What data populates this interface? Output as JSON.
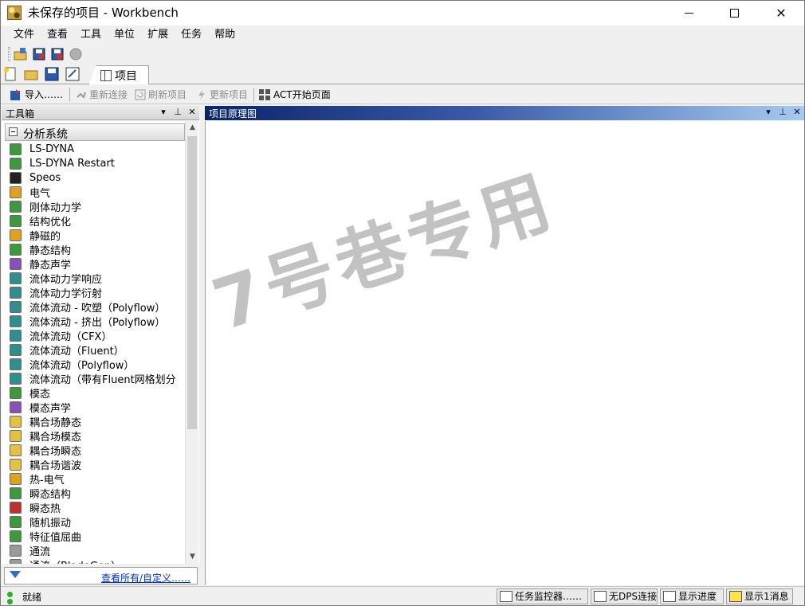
{
  "window": {
    "title": "未保存的项目 - Workbench",
    "controls": {
      "minimize": "—",
      "maximize": "☐",
      "close": "✕"
    }
  },
  "menu": [
    "文件",
    "查看",
    "工具",
    "单位",
    "扩展",
    "任务",
    "帮助"
  ],
  "tabs": {
    "project": "项目"
  },
  "toolbar3": {
    "import": "导入……",
    "reconnect": "重新连接",
    "refresh": "刷新项目",
    "update": "更新项目",
    "act_start": "ACT开始页面"
  },
  "toolbox": {
    "header": "工具箱",
    "group": "分析系统",
    "items": [
      {
        "label": "LS-DYNA",
        "icon": "green"
      },
      {
        "label": "LS-DYNA Restart",
        "icon": "green"
      },
      {
        "label": "Speos",
        "icon": "dark"
      },
      {
        "label": "电气",
        "icon": "orange"
      },
      {
        "label": "刚体动力学",
        "icon": "green"
      },
      {
        "label": "结构优化",
        "icon": "green"
      },
      {
        "label": "静磁的",
        "icon": "orange"
      },
      {
        "label": "静态结构",
        "icon": "green"
      },
      {
        "label": "静态声学",
        "icon": "purple"
      },
      {
        "label": "流体动力学响应",
        "icon": "teal"
      },
      {
        "label": "流体动力学衍射",
        "icon": "teal"
      },
      {
        "label": "流体流动 - 吹塑（Polyflow）",
        "icon": "teal"
      },
      {
        "label": "流体流动 - 挤出（Polyflow）",
        "icon": "teal"
      },
      {
        "label": "流体流动（CFX）",
        "icon": "teal"
      },
      {
        "label": "流体流动（Fluent）",
        "icon": "teal"
      },
      {
        "label": "流体流动（Polyflow）",
        "icon": "teal"
      },
      {
        "label": "流体流动（带有Fluent网格划分",
        "icon": "teal"
      },
      {
        "label": "模态",
        "icon": "green"
      },
      {
        "label": "模态声学",
        "icon": "purple"
      },
      {
        "label": "耦合场静态",
        "icon": "yellow"
      },
      {
        "label": "耦合场模态",
        "icon": "yellow"
      },
      {
        "label": "耦合场瞬态",
        "icon": "yellow"
      },
      {
        "label": "耦合场谐波",
        "icon": "yellow"
      },
      {
        "label": "热-电气",
        "icon": "orange"
      },
      {
        "label": "瞬态结构",
        "icon": "green"
      },
      {
        "label": "瞬态热",
        "icon": "red"
      },
      {
        "label": "随机振动",
        "icon": "green"
      },
      {
        "label": "特征值屈曲",
        "icon": "green"
      },
      {
        "label": "通流",
        "icon": "gray"
      },
      {
        "label": "通流（BladeGen）",
        "icon": "gray"
      }
    ],
    "footer_link": "查看所有/自定义……"
  },
  "schematic": {
    "header": "项目原理图",
    "watermark": "7号巷专用"
  },
  "status": {
    "text": "就绪",
    "buttons": {
      "task_monitor": "任务监控器……",
      "dps": "无DPS连接",
      "progress": "显示进度",
      "messages": "显示1消息"
    }
  },
  "panel_controls": {
    "dropdown": "▾",
    "pin": "⊥",
    "close": "✕"
  }
}
